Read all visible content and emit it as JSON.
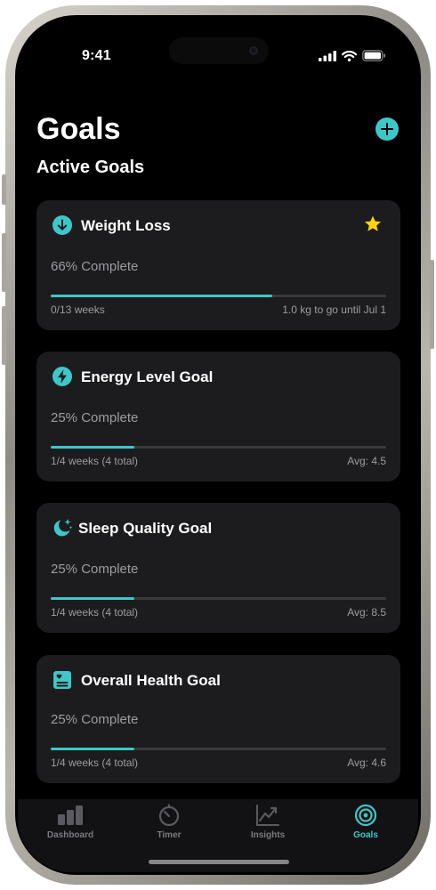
{
  "status_bar": {
    "time": "9:41"
  },
  "header": {
    "title": "Goals",
    "section_title": "Active Goals"
  },
  "goals": [
    {
      "title": "Weight Loss",
      "percent_text": "66% Complete",
      "progress": 0.66,
      "meta_left": "0/13 weeks",
      "meta_right": "1.0 kg to go until Jul 1",
      "icon": "arrow-down-circle-icon",
      "starred": true
    },
    {
      "title": "Energy Level Goal",
      "percent_text": "25% Complete",
      "progress": 0.25,
      "meta_left": "1/4 weeks (4 total)",
      "meta_right": "Avg: 4.5",
      "icon": "bolt-circle-icon",
      "starred": false
    },
    {
      "title": "Sleep Quality Goal",
      "percent_text": "25% Complete",
      "progress": 0.25,
      "meta_left": "1/4 weeks (4 total)",
      "meta_right": "Avg: 8.5",
      "icon": "moon-stars-icon",
      "starred": false
    },
    {
      "title": "Overall Health Goal",
      "percent_text": "25% Complete",
      "progress": 0.25,
      "meta_left": "1/4 weeks (4 total)",
      "meta_right": "Avg: 4.6",
      "icon": "health-card-icon",
      "starred": false
    }
  ],
  "tabs": [
    {
      "label": "Dashboard",
      "icon": "bar-chart-icon",
      "active": false
    },
    {
      "label": "Timer",
      "icon": "timer-icon",
      "active": false
    },
    {
      "label": "Insights",
      "icon": "trend-chart-icon",
      "active": false
    },
    {
      "label": "Goals",
      "icon": "target-icon",
      "active": true
    }
  ],
  "colors": {
    "accent": "#3ec7c8",
    "card": "#1c1c1e",
    "star": "#ffd60a",
    "muted_text": "#9c9ca2",
    "background": "#000000"
  }
}
